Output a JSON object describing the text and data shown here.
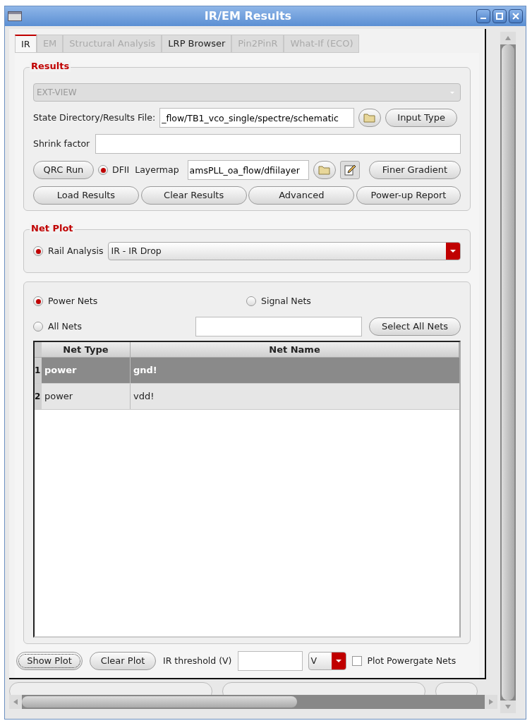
{
  "window": {
    "title": "IR/EM Results"
  },
  "tabs": [
    {
      "label": "IR",
      "selected": true,
      "disabled": false
    },
    {
      "label": "EM",
      "selected": false,
      "disabled": true
    },
    {
      "label": "Structural Analysis",
      "selected": false,
      "disabled": true
    },
    {
      "label": "LRP Browser",
      "selected": false,
      "disabled": false
    },
    {
      "label": "Pin2PinR",
      "selected": false,
      "disabled": true
    },
    {
      "label": "What-If (ECO)",
      "selected": false,
      "disabled": true
    }
  ],
  "results": {
    "title": "Results",
    "view": {
      "value": "EXT-VIEW",
      "disabled": true
    },
    "state_label": "State Directory/Results File:",
    "state_value": "_flow/TB1_vco_single/spectre/schematic",
    "input_type_button": "Input Type",
    "shrink_label": "Shrink factor",
    "qrc_button": "QRC Run",
    "dfii": {
      "label": "DFII",
      "selected": true
    },
    "layermap_label": "Layermap",
    "layermap_value": "amsPLL_oa_flow/dfiilayer",
    "finer_button": "Finer Gradient",
    "buttons": [
      "Load Results",
      "Clear Results",
      "Advanced",
      "Power-up Report"
    ]
  },
  "net_plot": {
    "title": "Net Plot",
    "rail": {
      "label": "Rail Analysis",
      "selected": true
    },
    "rail_value": "IR - IR Drop"
  },
  "nets": {
    "options": [
      {
        "label": "Power Nets",
        "selected": true
      },
      {
        "label": "Signal Nets",
        "selected": false
      },
      {
        "label": "All Nets",
        "selected": false
      }
    ],
    "select_all_button": "Select All Nets",
    "table": {
      "columns": [
        "Net Type",
        "Net Name"
      ],
      "rows": [
        {
          "index": "1",
          "net_type": "power",
          "net_name": "gnd!",
          "selected": true
        },
        {
          "index": "2",
          "net_type": "power",
          "net_name": "vdd!",
          "selected": false
        }
      ]
    }
  },
  "footer": {
    "show_plot": "Show Plot",
    "clear_plot": "Clear Plot",
    "threshold_label": "IR threshold (V)",
    "unit": "V",
    "powergate": {
      "label": "Plot Powergate Nets",
      "checked": false
    }
  }
}
